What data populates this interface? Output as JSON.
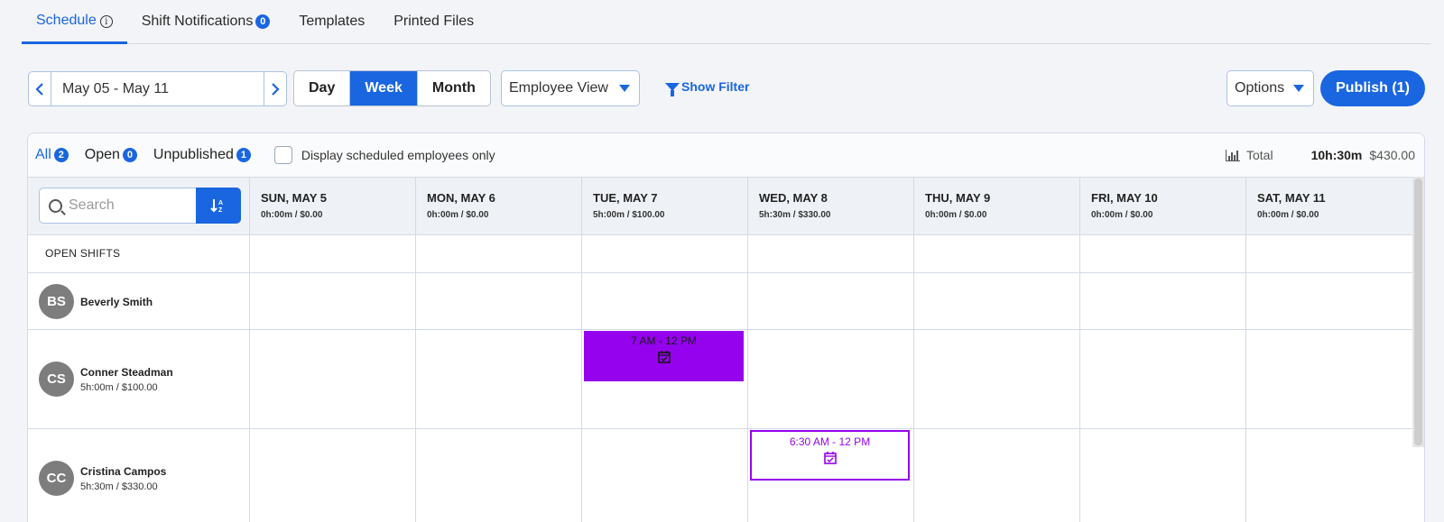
{
  "tabs": [
    {
      "label": "Schedule",
      "active": true
    },
    {
      "label": "Shift Notifications",
      "badge": "0"
    },
    {
      "label": "Templates"
    },
    {
      "label": "Printed Files"
    }
  ],
  "toolbar": {
    "date_range": "May 05 - May 11",
    "views": [
      "Day",
      "Week",
      "Month"
    ],
    "active_view": "Week",
    "view_mode": "Employee View",
    "show_filter": "Show Filter",
    "options": "Options",
    "publish": "Publish (1)"
  },
  "filters": {
    "all": {
      "label": "All",
      "count": "2"
    },
    "open": {
      "label": "Open",
      "count": "0"
    },
    "unpublished": {
      "label": "Unpublished",
      "count": "1"
    },
    "checkbox_label": "Display scheduled employees only"
  },
  "totals": {
    "label": "Total",
    "hours": "10h:30m",
    "amount": "$430.00"
  },
  "search": {
    "placeholder": "Search"
  },
  "days": [
    {
      "title": "SUN, MAY 5",
      "sub": "0h:00m / $0.00"
    },
    {
      "title": "MON, MAY 6",
      "sub": "0h:00m / $0.00"
    },
    {
      "title": "TUE, MAY 7",
      "sub": "5h:00m / $100.00"
    },
    {
      "title": "WED, MAY 8",
      "sub": "5h:30m / $330.00"
    },
    {
      "title": "THU, MAY 9",
      "sub": "0h:00m / $0.00"
    },
    {
      "title": "FRI, MAY 10",
      "sub": "0h:00m / $0.00"
    },
    {
      "title": "SAT, MAY 11",
      "sub": "0h:00m / $0.00"
    }
  ],
  "open_shifts_label": "OPEN SHIFTS",
  "employees": [
    {
      "initials": "BS",
      "name": "Beverly Smith",
      "sub": ""
    },
    {
      "initials": "CS",
      "name": "Conner Steadman",
      "sub": "5h:00m / $100.00"
    },
    {
      "initials": "CC",
      "name": "Cristina Campos",
      "sub": "5h:30m / $330.00"
    }
  ],
  "shifts": [
    {
      "employee": "Conner Steadman",
      "day": "TUE, MAY 7",
      "time": "7 AM - 12 PM",
      "status": "published",
      "color": "#9502ee"
    },
    {
      "employee": "Cristina Campos",
      "day": "WED, MAY 8",
      "time": "6:30 AM - 12 PM",
      "status": "unpublished",
      "color": "#9502ee"
    }
  ],
  "colors": {
    "accent": "#1a66e0",
    "shift": "#9502ee"
  }
}
